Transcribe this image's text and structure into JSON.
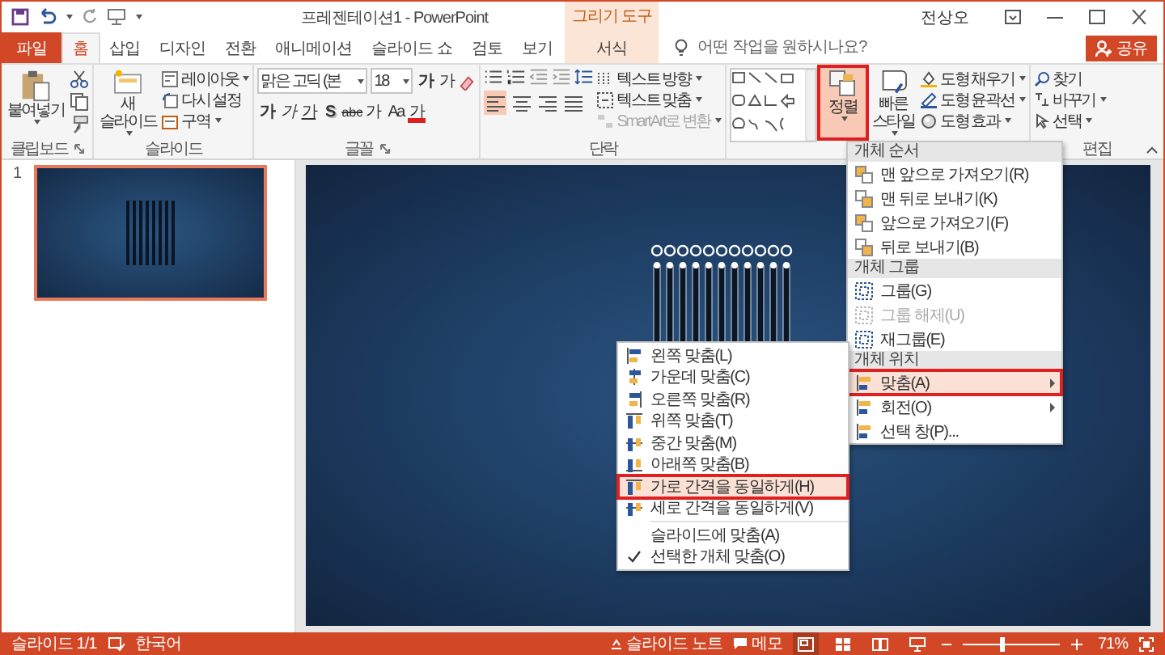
{
  "window": {
    "title": "프레젠테이션1 - PowerPoint",
    "context_label": "그리기 도구",
    "user": "전상오"
  },
  "tabs": [
    {
      "label": "파일",
      "kind": "file",
      "selected": false
    },
    {
      "label": "홈",
      "kind": "normal",
      "selected": true
    },
    {
      "label": "삽입",
      "kind": "normal",
      "selected": false
    },
    {
      "label": "디자인",
      "kind": "normal",
      "selected": false
    },
    {
      "label": "전환",
      "kind": "normal",
      "selected": false
    },
    {
      "label": "애니메이션",
      "kind": "normal",
      "selected": false
    },
    {
      "label": "슬라이드 쇼",
      "kind": "normal",
      "selected": false
    },
    {
      "label": "검토",
      "kind": "normal",
      "selected": false
    },
    {
      "label": "보기",
      "kind": "normal",
      "selected": false
    },
    {
      "label": "서식",
      "kind": "context",
      "selected": false
    }
  ],
  "tell_me": {
    "placeholder": "어떤 작업을 원하시나요?"
  },
  "share_button": {
    "label": "공유"
  },
  "ribbon": {
    "clipboard": {
      "paste": "붙여넣기",
      "group_label": "클립보드"
    },
    "slides": {
      "new_slide": "새 슬라이드",
      "layout": "레이아웃",
      "reset": "다시 설정",
      "section": "구역",
      "group_label": "슬라이드"
    },
    "font": {
      "name": "맑은 고딕 (본",
      "size": "18",
      "grow": "가",
      "shrink": "가",
      "group_label": "글꼴",
      "format_buttons": [
        {
          "label": "가",
          "kind": "bold"
        },
        {
          "label": "가",
          "kind": "italic"
        },
        {
          "label": "가",
          "kind": "underline"
        },
        {
          "label": "S",
          "kind": "shadow"
        },
        {
          "label": "abc",
          "kind": "strike"
        },
        {
          "label": "가",
          "kind": "spacing"
        },
        {
          "label": "Aa",
          "kind": "case"
        },
        {
          "label": "가",
          "kind": "color"
        }
      ]
    },
    "paragraph": {
      "group_label": "단락",
      "alignment": [
        {
          "kind": "left",
          "selected": true
        },
        {
          "kind": "center",
          "selected": false
        },
        {
          "kind": "right",
          "selected": false
        },
        {
          "kind": "justify",
          "selected": false
        }
      ],
      "text_direction": "텍스트 방향",
      "align_text": "텍스트 맞춤",
      "smartart": {
        "label": "SmartArt로 변환",
        "disabled": true
      }
    },
    "drawing": {
      "arrange": {
        "label": "정렬",
        "highlighted": true
      },
      "quick_styles": "빠른 스타일",
      "shape_fill": "도형 채우기",
      "shape_outline": "도형 윤곽선",
      "shape_effects": "도형 효과"
    },
    "editing": {
      "find": "찾기",
      "replace": "바꾸기",
      "select": "선택",
      "group_label": "편집"
    }
  },
  "slides": [
    {
      "number": "1",
      "selected": true
    }
  ],
  "arrange_menu": {
    "sections": [
      {
        "title": "개체 순서",
        "kind": "order",
        "items": [
          {
            "label": "맨 앞으로 가져오기(R)",
            "disabled": false,
            "highlighted": false,
            "submenu": false
          },
          {
            "label": "맨 뒤로 보내기(K)",
            "disabled": false,
            "highlighted": false,
            "submenu": false
          },
          {
            "label": "앞으로 가져오기(F)",
            "disabled": false,
            "highlighted": false,
            "submenu": false
          },
          {
            "label": "뒤로 보내기(B)",
            "disabled": false,
            "highlighted": false,
            "submenu": false
          }
        ]
      },
      {
        "title": "개체 그룹",
        "kind": "group",
        "items": [
          {
            "label": "그룹(G)",
            "disabled": false,
            "highlighted": false,
            "submenu": false
          },
          {
            "label": "그룹 해제(U)",
            "disabled": true,
            "highlighted": false,
            "submenu": false
          },
          {
            "label": "재그룹(E)",
            "disabled": false,
            "highlighted": false,
            "submenu": false
          }
        ]
      },
      {
        "title": "개체 위치",
        "kind": "position",
        "items": [
          {
            "label": "맞춤(A)",
            "disabled": false,
            "highlighted": true,
            "submenu": true
          },
          {
            "label": "회전(O)",
            "disabled": false,
            "highlighted": false,
            "submenu": true
          },
          {
            "label": "선택 창(P)...",
            "disabled": false,
            "highlighted": false,
            "submenu": false
          }
        ]
      }
    ]
  },
  "align_submenu": {
    "groups": [
      {
        "icons": true,
        "items": [
          {
            "label": "왼쪽 맞춤(L)",
            "highlighted": false
          },
          {
            "label": "가운데 맞춤(C)",
            "highlighted": false
          },
          {
            "label": "오른쪽 맞춤(R)",
            "highlighted": false
          },
          {
            "label": "위쪽 맞춤(T)",
            "highlighted": false
          },
          {
            "label": "중간 맞춤(M)",
            "highlighted": false
          },
          {
            "label": "아래쪽 맞춤(B)",
            "highlighted": false
          },
          {
            "label": "가로 간격을 동일하게(H)",
            "highlighted": true
          },
          {
            "label": "세로 간격을 동일하게(V)",
            "highlighted": false
          }
        ]
      },
      {
        "icons": false,
        "items": [
          {
            "label": "슬라이드에 맞춤(A)",
            "highlighted": false,
            "checked": false
          },
          {
            "label": "선택한 개체 맞춤(O)",
            "highlighted": false,
            "checked": true
          }
        ]
      }
    ]
  },
  "status_bar": {
    "slide": "슬라이드 1/1",
    "language": "한국어",
    "notes": "슬라이드 노트",
    "comments": "메모",
    "views": [
      {
        "kind": "normal",
        "selected": true
      },
      {
        "kind": "sorter",
        "selected": false
      },
      {
        "kind": "reading",
        "selected": false
      },
      {
        "kind": "slideshow",
        "selected": false
      }
    ],
    "zoom": {
      "level": 0.4
    },
    "zoom_label": "71%"
  }
}
